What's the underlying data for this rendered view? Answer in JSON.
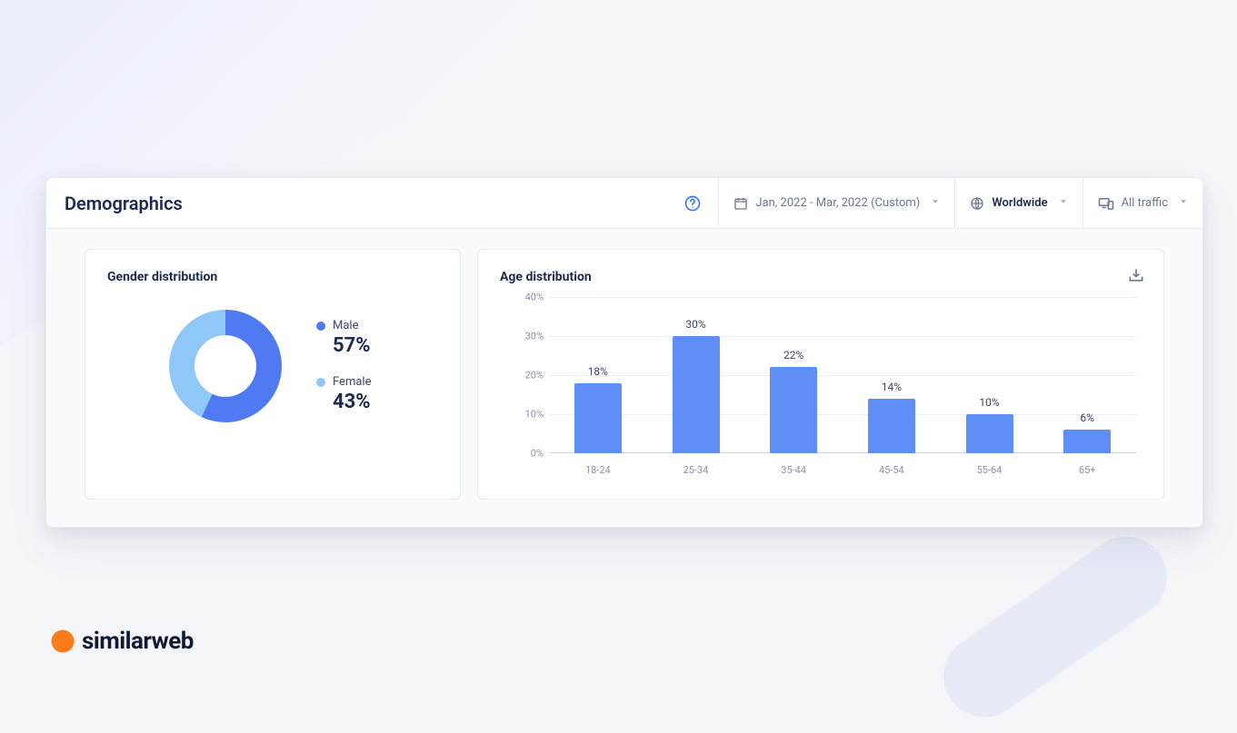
{
  "header": {
    "title": "Demographics",
    "date_range": "Jan, 2022 - Mar, 2022 (Custom)",
    "region": "Worldwide",
    "traffic": "All traffic"
  },
  "gender": {
    "title": "Gender distribution",
    "series": [
      {
        "name": "Male",
        "label": "Male",
        "value": 57,
        "display": "57%",
        "color": "#4f79f0"
      },
      {
        "name": "Female",
        "label": "Female",
        "value": 43,
        "display": "43%",
        "color": "#8fc7f8"
      }
    ]
  },
  "age": {
    "title": "Age distribution"
  },
  "brand": {
    "name": "similarweb"
  },
  "chart_data": [
    {
      "type": "pie",
      "title": "Gender distribution",
      "series": [
        {
          "name": "Male",
          "value": 57
        },
        {
          "name": "Female",
          "value": 43
        }
      ],
      "colors": [
        "#4f79f0",
        "#8fc7f8"
      ]
    },
    {
      "type": "bar",
      "title": "Age distribution",
      "categories": [
        "18-24",
        "25-34",
        "35-44",
        "45-54",
        "55-64",
        "65+"
      ],
      "values": [
        18,
        30,
        22,
        14,
        10,
        6
      ],
      "ylabel": "%",
      "ylim": [
        0,
        40
      ],
      "yticks": [
        0,
        10,
        20,
        30,
        40
      ],
      "bar_color": "#5f8ef7"
    }
  ]
}
